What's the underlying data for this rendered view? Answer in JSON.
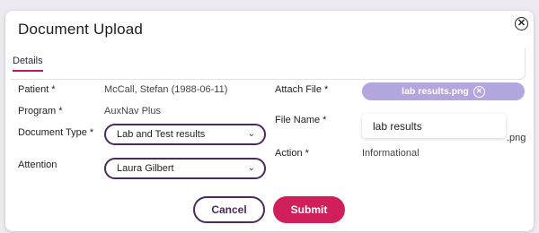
{
  "dialog": {
    "title": "Document Upload",
    "close_icon": "close-circle-icon",
    "close_glyph": "✕"
  },
  "tabs": [
    {
      "label": "Details",
      "active": true
    }
  ],
  "form": {
    "patient_label": "Patient *",
    "patient_value": "McCall, Stefan (1988-06-11)",
    "program_label": "Program *",
    "program_value": "AuxNav Plus",
    "doc_type_label": "Document Type *",
    "doc_type_value": "Lab and Test results",
    "attention_label": "Attention",
    "attention_value": "Laura Gilbert",
    "attach_label": "Attach File *",
    "attach_chip": "lab results.png",
    "file_name_label": "File Name *",
    "file_name_value": "lab results",
    "file_ext": ".png",
    "action_label": "Action *",
    "action_value": "Informational",
    "chevron_icon": "chevron-down-icon",
    "chevron_glyph": "⌄"
  },
  "buttons": {
    "cancel": "Cancel",
    "submit": "Submit"
  },
  "colors": {
    "accent": "#d01f5b",
    "outline": "#4b2a5c",
    "chip": "#b3a6de"
  }
}
